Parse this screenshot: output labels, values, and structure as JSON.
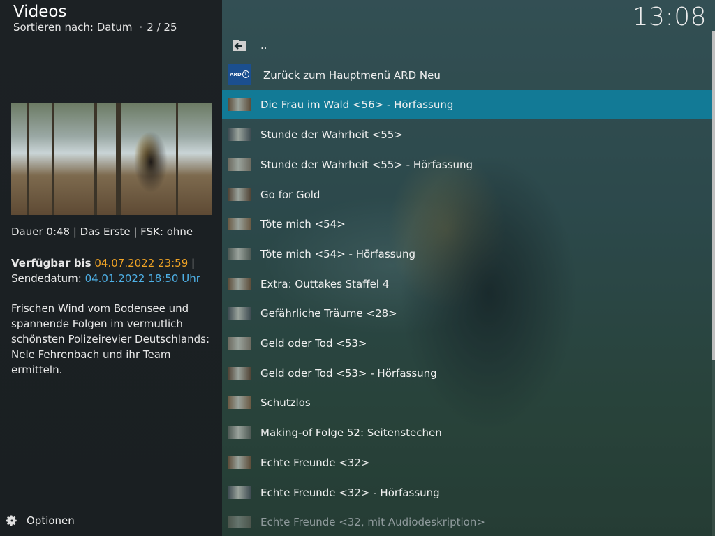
{
  "header": {
    "title": "Videos",
    "sort_label": "Sortieren nach: Datum",
    "position": "2 / 25"
  },
  "clock": "13:08",
  "details": {
    "meta_line": "Dauer 0:48 | Das Erste | FSK: ohne",
    "available_label": "Verfügbar bis",
    "available_value": "04.07.2022 23:59",
    "available_sep": "|",
    "broadcast_label": "Sendedatum:",
    "broadcast_value": "04.01.2022 18:50 Uhr",
    "description": "Frischen Wind vom Bodensee und spannende Folgen im vermutlich schönsten Polizeirevier Deutschlands: Nele Fehrenbach und ihr Team ermitteln."
  },
  "footer": {
    "options_label": "Optionen"
  },
  "list": {
    "items": [
      {
        "label": "..",
        "icon": "folder-back-icon"
      },
      {
        "label": "Zurück zum Hauptmenü ARD Neu",
        "icon": "ard-logo-icon"
      },
      {
        "label": "Die Frau im Wald <56> - Hörfassung",
        "icon": "thumbnail-icon",
        "selected": true
      },
      {
        "label": "Stunde der Wahrheit <55>",
        "icon": "thumbnail-icon"
      },
      {
        "label": "Stunde der Wahrheit <55> - Hörfassung",
        "icon": "thumbnail-icon"
      },
      {
        "label": "Go for Gold",
        "icon": "thumbnail-icon"
      },
      {
        "label": "Töte mich <54>",
        "icon": "thumbnail-icon"
      },
      {
        "label": "Töte mich <54> - Hörfassung",
        "icon": "thumbnail-icon"
      },
      {
        "label": "Extra: Outtakes Staffel 4",
        "icon": "thumbnail-icon"
      },
      {
        "label": "Gefährliche Träume <28>",
        "icon": "thumbnail-icon"
      },
      {
        "label": "Geld oder Tod <53>",
        "icon": "thumbnail-icon"
      },
      {
        "label": "Geld oder Tod <53> - Hörfassung",
        "icon": "thumbnail-icon"
      },
      {
        "label": "Schutzlos",
        "icon": "thumbnail-icon"
      },
      {
        "label": "Making-of Folge 52: Seitenstechen",
        "icon": "thumbnail-icon"
      },
      {
        "label": "Echte Freunde <32>",
        "icon": "thumbnail-icon"
      },
      {
        "label": "Echte Freunde <32> - Hörfassung",
        "icon": "thumbnail-icon"
      },
      {
        "label": "Echte Freunde <32, mit Audiodeskription>",
        "icon": "thumbnail-icon",
        "faded": true
      }
    ]
  },
  "colors": {
    "selection": "#127a96",
    "available_date": "#f0a325",
    "broadcast_date": "#4eb0e6"
  }
}
